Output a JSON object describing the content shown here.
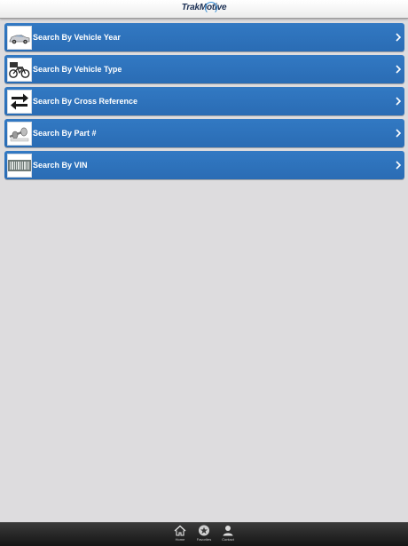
{
  "header": {
    "logo_text": "TrakMotive"
  },
  "menu": {
    "items": [
      {
        "label": "Search By Vehicle Year",
        "icon": "car-icon"
      },
      {
        "label": "Search By Vehicle Type",
        "icon": "motorcycle-icon"
      },
      {
        "label": "Search By Cross Reference",
        "icon": "swap-arrows-icon"
      },
      {
        "label": "Search By Part #",
        "icon": "axle-part-icon"
      },
      {
        "label": "Search By VIN",
        "icon": "barcode-icon"
      }
    ]
  },
  "tabbar": {
    "tabs": [
      {
        "label": "Home",
        "icon": "home-icon"
      },
      {
        "label": "Favorites",
        "icon": "star-icon"
      },
      {
        "label": "Contact",
        "icon": "person-icon"
      }
    ]
  },
  "colors": {
    "row_blue": "#2a6cb4",
    "background": "#dddcde",
    "tabbar": "#1f1f1f"
  }
}
